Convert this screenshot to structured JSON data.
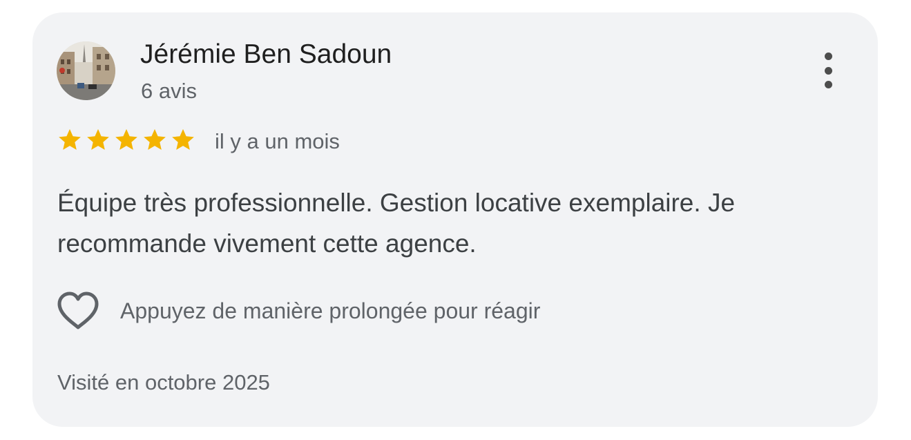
{
  "review": {
    "author": {
      "name": "Jérémie Ben Sadoun",
      "review_count": "6 avis",
      "avatar_icon": "street-photo-avatar"
    },
    "rating": {
      "value": 5,
      "max": 5,
      "star_color": "#f4b400"
    },
    "date": "il y a un mois",
    "text": "Équipe très professionnelle. Gestion locative exemplaire. Je recommande vivement cette agence.",
    "reaction_hint": "Appuyez de manière prolongée pour réagir",
    "visit": "Visité en octobre 2025",
    "menu_icon": "more-vert-icon"
  },
  "colors": {
    "card_background": "#f2f3f5",
    "primary_text": "#1f1f1f",
    "secondary_text": "#5f6368"
  }
}
